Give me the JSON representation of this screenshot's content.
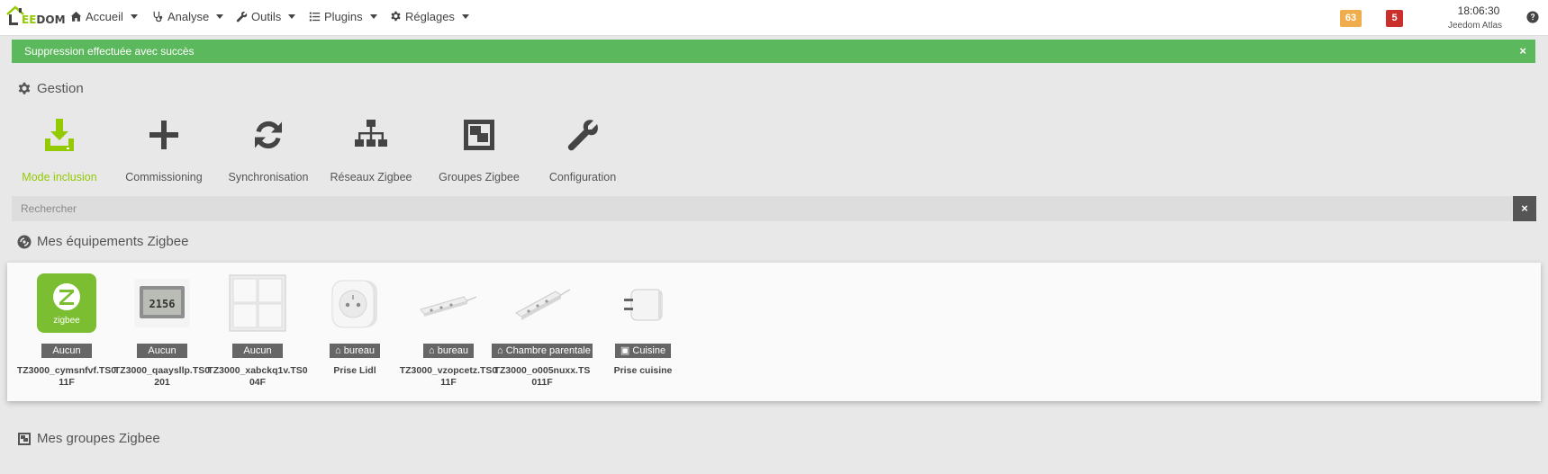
{
  "navbar": {
    "brand_prefix": "EE",
    "brand_suffix": "DOM",
    "menu": [
      {
        "label": "Accueil",
        "icon": "home-icon"
      },
      {
        "label": "Analyse",
        "icon": "stethoscope-icon"
      },
      {
        "label": "Outils",
        "icon": "wrench-icon"
      },
      {
        "label": "Plugins",
        "icon": "list-icon"
      },
      {
        "label": "Réglages",
        "icon": "gear-icon"
      }
    ],
    "badge_orange": "63",
    "badge_red": "5",
    "time": "18:06:30",
    "hostname": "Jeedom Atlas"
  },
  "alert": {
    "message": "Suppression effectuée avec succès",
    "close": "×"
  },
  "gestion": {
    "title": "Gestion",
    "actions": [
      {
        "label": "Mode inclusion",
        "icon": "download-icon"
      },
      {
        "label": "Commissioning",
        "icon": "plus-icon"
      },
      {
        "label": "Synchronisation",
        "icon": "refresh-icon"
      },
      {
        "label": "Réseaux Zigbee",
        "icon": "sitemap-icon"
      },
      {
        "label": "Groupes Zigbee",
        "icon": "group-object-icon"
      },
      {
        "label": "Configuration",
        "icon": "wrench-icon"
      }
    ]
  },
  "search": {
    "placeholder": "Rechercher",
    "clear": "×"
  },
  "equipments": {
    "title": "Mes équipements Zigbee",
    "items": [
      {
        "tag": "Aucun",
        "name": "TZ3000_cymsnfvf.TS011F",
        "image": "zigbee-logo"
      },
      {
        "tag": "Aucun",
        "name": "TZ3000_qaaysllp.TS0201",
        "image": "thermometer-display"
      },
      {
        "tag": "Aucun",
        "name": "TZ3000_xabckq1v.TS004F",
        "image": "wall-switch-4gang"
      },
      {
        "tag": "bureau",
        "name": "Prise Lidl",
        "image": "smart-plug-fr"
      },
      {
        "tag": "bureau",
        "name": "TZ3000_vzopcetz.TS011F",
        "image": "power-strip"
      },
      {
        "tag": "Chambre parentale",
        "name": "TZ3000_o005nuxx.TS011F",
        "image": "power-strip-angle"
      },
      {
        "tag": "Cuisine",
        "name": "Prise cuisine",
        "image": "smart-plug-eu"
      }
    ]
  },
  "groups": {
    "title": "Mes groupes Zigbee"
  }
}
